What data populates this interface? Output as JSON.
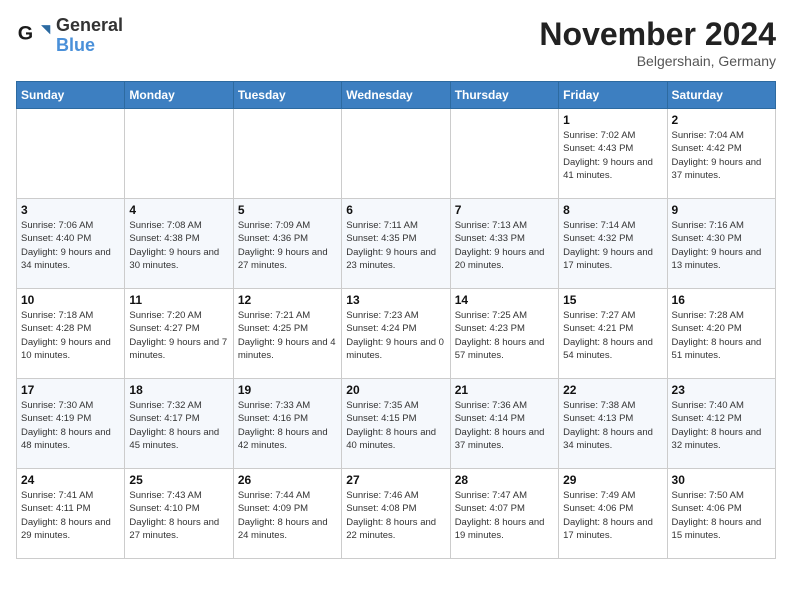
{
  "header": {
    "logo_line1": "General",
    "logo_line2": "Blue",
    "month_title": "November 2024",
    "location": "Belgershain, Germany"
  },
  "calendar": {
    "days_of_week": [
      "Sunday",
      "Monday",
      "Tuesday",
      "Wednesday",
      "Thursday",
      "Friday",
      "Saturday"
    ],
    "weeks": [
      [
        {
          "day": "",
          "info": ""
        },
        {
          "day": "",
          "info": ""
        },
        {
          "day": "",
          "info": ""
        },
        {
          "day": "",
          "info": ""
        },
        {
          "day": "",
          "info": ""
        },
        {
          "day": "1",
          "info": "Sunrise: 7:02 AM\nSunset: 4:43 PM\nDaylight: 9 hours and 41 minutes."
        },
        {
          "day": "2",
          "info": "Sunrise: 7:04 AM\nSunset: 4:42 PM\nDaylight: 9 hours and 37 minutes."
        }
      ],
      [
        {
          "day": "3",
          "info": "Sunrise: 7:06 AM\nSunset: 4:40 PM\nDaylight: 9 hours and 34 minutes."
        },
        {
          "day": "4",
          "info": "Sunrise: 7:08 AM\nSunset: 4:38 PM\nDaylight: 9 hours and 30 minutes."
        },
        {
          "day": "5",
          "info": "Sunrise: 7:09 AM\nSunset: 4:36 PM\nDaylight: 9 hours and 27 minutes."
        },
        {
          "day": "6",
          "info": "Sunrise: 7:11 AM\nSunset: 4:35 PM\nDaylight: 9 hours and 23 minutes."
        },
        {
          "day": "7",
          "info": "Sunrise: 7:13 AM\nSunset: 4:33 PM\nDaylight: 9 hours and 20 minutes."
        },
        {
          "day": "8",
          "info": "Sunrise: 7:14 AM\nSunset: 4:32 PM\nDaylight: 9 hours and 17 minutes."
        },
        {
          "day": "9",
          "info": "Sunrise: 7:16 AM\nSunset: 4:30 PM\nDaylight: 9 hours and 13 minutes."
        }
      ],
      [
        {
          "day": "10",
          "info": "Sunrise: 7:18 AM\nSunset: 4:28 PM\nDaylight: 9 hours and 10 minutes."
        },
        {
          "day": "11",
          "info": "Sunrise: 7:20 AM\nSunset: 4:27 PM\nDaylight: 9 hours and 7 minutes."
        },
        {
          "day": "12",
          "info": "Sunrise: 7:21 AM\nSunset: 4:25 PM\nDaylight: 9 hours and 4 minutes."
        },
        {
          "day": "13",
          "info": "Sunrise: 7:23 AM\nSunset: 4:24 PM\nDaylight: 9 hours and 0 minutes."
        },
        {
          "day": "14",
          "info": "Sunrise: 7:25 AM\nSunset: 4:23 PM\nDaylight: 8 hours and 57 minutes."
        },
        {
          "day": "15",
          "info": "Sunrise: 7:27 AM\nSunset: 4:21 PM\nDaylight: 8 hours and 54 minutes."
        },
        {
          "day": "16",
          "info": "Sunrise: 7:28 AM\nSunset: 4:20 PM\nDaylight: 8 hours and 51 minutes."
        }
      ],
      [
        {
          "day": "17",
          "info": "Sunrise: 7:30 AM\nSunset: 4:19 PM\nDaylight: 8 hours and 48 minutes."
        },
        {
          "day": "18",
          "info": "Sunrise: 7:32 AM\nSunset: 4:17 PM\nDaylight: 8 hours and 45 minutes."
        },
        {
          "day": "19",
          "info": "Sunrise: 7:33 AM\nSunset: 4:16 PM\nDaylight: 8 hours and 42 minutes."
        },
        {
          "day": "20",
          "info": "Sunrise: 7:35 AM\nSunset: 4:15 PM\nDaylight: 8 hours and 40 minutes."
        },
        {
          "day": "21",
          "info": "Sunrise: 7:36 AM\nSunset: 4:14 PM\nDaylight: 8 hours and 37 minutes."
        },
        {
          "day": "22",
          "info": "Sunrise: 7:38 AM\nSunset: 4:13 PM\nDaylight: 8 hours and 34 minutes."
        },
        {
          "day": "23",
          "info": "Sunrise: 7:40 AM\nSunset: 4:12 PM\nDaylight: 8 hours and 32 minutes."
        }
      ],
      [
        {
          "day": "24",
          "info": "Sunrise: 7:41 AM\nSunset: 4:11 PM\nDaylight: 8 hours and 29 minutes."
        },
        {
          "day": "25",
          "info": "Sunrise: 7:43 AM\nSunset: 4:10 PM\nDaylight: 8 hours and 27 minutes."
        },
        {
          "day": "26",
          "info": "Sunrise: 7:44 AM\nSunset: 4:09 PM\nDaylight: 8 hours and 24 minutes."
        },
        {
          "day": "27",
          "info": "Sunrise: 7:46 AM\nSunset: 4:08 PM\nDaylight: 8 hours and 22 minutes."
        },
        {
          "day": "28",
          "info": "Sunrise: 7:47 AM\nSunset: 4:07 PM\nDaylight: 8 hours and 19 minutes."
        },
        {
          "day": "29",
          "info": "Sunrise: 7:49 AM\nSunset: 4:06 PM\nDaylight: 8 hours and 17 minutes."
        },
        {
          "day": "30",
          "info": "Sunrise: 7:50 AM\nSunset: 4:06 PM\nDaylight: 8 hours and 15 minutes."
        }
      ]
    ]
  }
}
